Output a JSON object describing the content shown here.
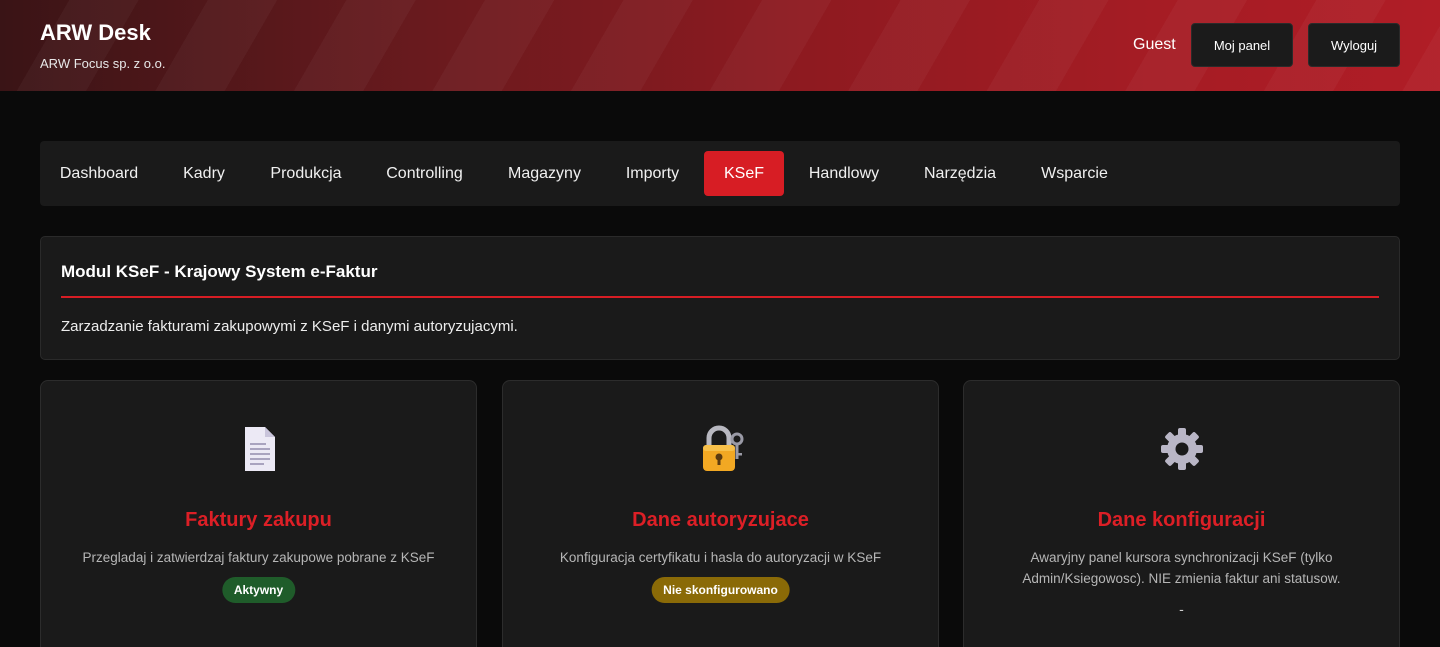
{
  "header": {
    "title": "ARW Desk",
    "subtitle": "ARW Focus sp. z o.o.",
    "user": "Guest",
    "panel_button": "Moj panel",
    "logout_button": "Wyloguj"
  },
  "nav": {
    "items": [
      {
        "label": "Dashboard",
        "active": false
      },
      {
        "label": "Kadry",
        "active": false
      },
      {
        "label": "Produkcja",
        "active": false
      },
      {
        "label": "Controlling",
        "active": false
      },
      {
        "label": "Magazyny",
        "active": false
      },
      {
        "label": "Importy",
        "active": false
      },
      {
        "label": "KSeF",
        "active": true
      },
      {
        "label": "Handlowy",
        "active": false
      },
      {
        "label": "Narzędzia",
        "active": false
      },
      {
        "label": "Wsparcie",
        "active": false
      }
    ]
  },
  "module": {
    "title": "Modul KSeF - Krajowy System e-Faktur",
    "description": "Zarzadzanie fakturami zakupowymi z KSeF i danymi autoryzujacymi."
  },
  "cards": [
    {
      "icon": "document-icon",
      "title": "Faktury zakupu",
      "description": "Przegladaj i zatwierdzaj faktury zakupowe pobrane z KSeF",
      "badge": "Aktywny"
    },
    {
      "icon": "lock-key-icon",
      "title": "Dane autoryzujace",
      "description": "Konfiguracja certyfikatu i hasla do autoryzacji w KSeF",
      "badge": "Nie skonfigurowano"
    },
    {
      "icon": "gear-icon",
      "title": "Dane konfiguracji",
      "description": "Awaryjny panel kursora synchronizacji KSeF (tylko Admin/Ksiegowosc). NIE zmienia faktur ani statusow.",
      "status": "-"
    }
  ],
  "colors": {
    "accent": "#d71d24",
    "badge_active": "#1f5c2a",
    "badge_warning": "#8a6a07"
  }
}
